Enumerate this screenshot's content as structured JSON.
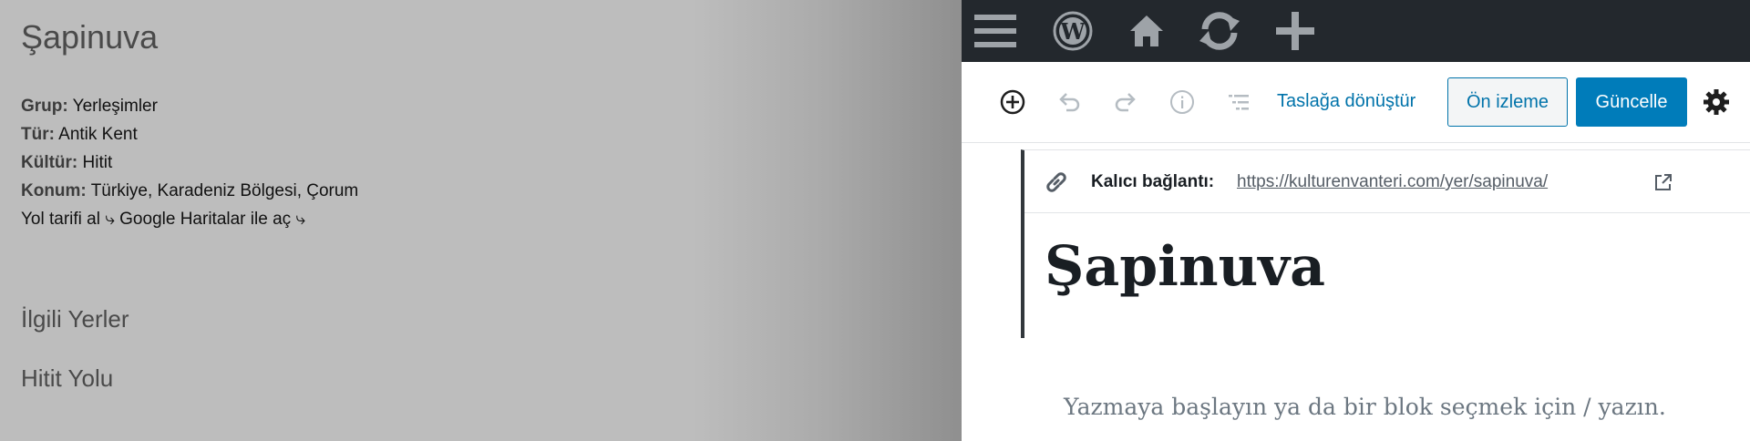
{
  "page": {
    "title": "Şapinuva",
    "meta": [
      {
        "label": "Grup:",
        "value": " Yerleşimler"
      },
      {
        "label": "Tür:",
        "value": " Antik Kent"
      },
      {
        "label": "Kültür:",
        "value": " Hitit"
      },
      {
        "label": "Konum:",
        "value": " Türkiye, Karadeniz Bölgesi, Çorum"
      }
    ],
    "directions": "Yol tarifi al ⤷ Google Haritalar ile aç ⤷",
    "sections": [
      "İlgili Yerler",
      "Hitit Yolu"
    ]
  },
  "admin_bar": {
    "icons": [
      "menu-icon",
      "wordpress-logo-icon",
      "home-icon",
      "refresh-icon",
      "plus-icon"
    ]
  },
  "toolbar": {
    "icons": [
      "add-block-icon",
      "undo-icon",
      "redo-icon",
      "info-icon",
      "outline-icon"
    ],
    "draft_label": "Taslağa dönüştür",
    "preview_label": "Ön izleme",
    "update_label": "Güncelle"
  },
  "editor": {
    "permalink_label": "Kalıcı bağlantı:",
    "permalink_url": "https://kulturenvanteri.com/yer/sapinuva/",
    "post_title": "Şapinuva",
    "placeholder": "Yazmaya başlayın ya da bir blok seçmek için / yazın."
  },
  "colors": {
    "admin_bar": "#23282d",
    "accent": "#0073aa",
    "primary_button": "#007cba"
  }
}
